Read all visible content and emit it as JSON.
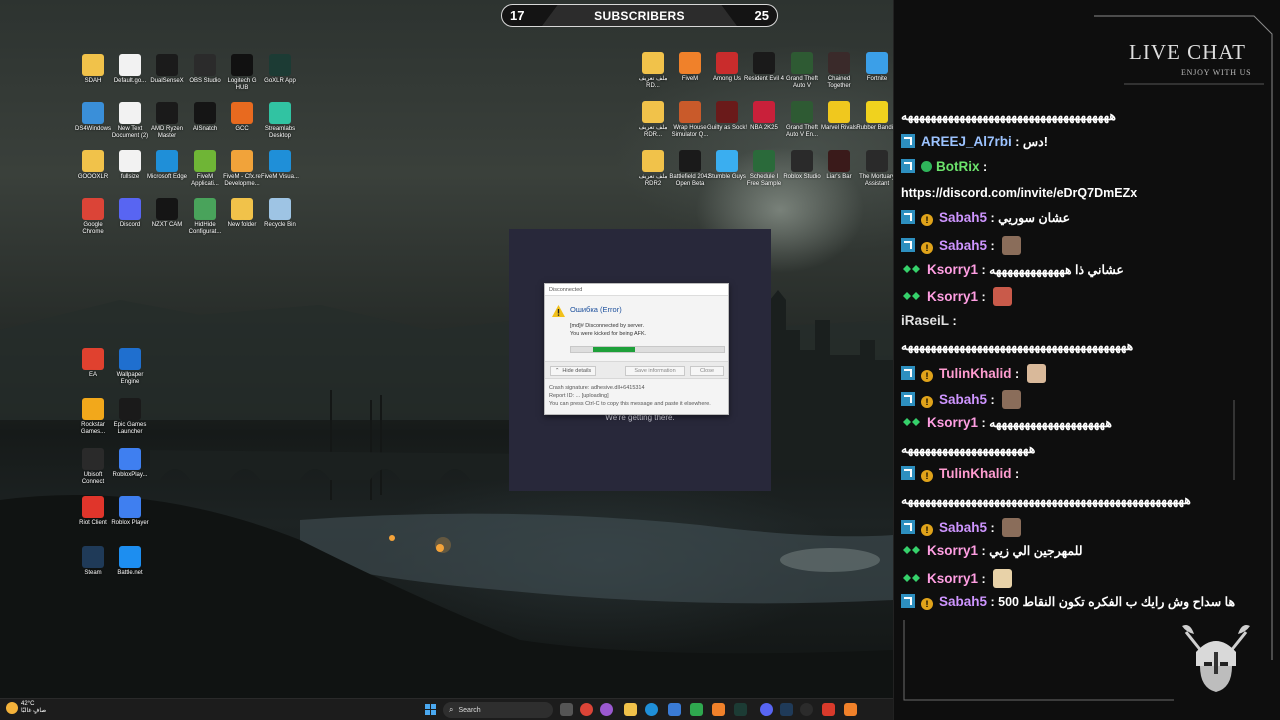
{
  "subscriber_bar": {
    "left": "17",
    "label": "SUBSCRIBERS",
    "right": "25"
  },
  "desktop_icons_left": [
    {
      "label": "SDAH",
      "color": "#f1c24a"
    },
    {
      "label": "Default.go...",
      "color": "#f2f2f2"
    },
    {
      "label": "DualSenseX",
      "color": "#1b1b1b"
    },
    {
      "label": "OBS Studio",
      "color": "#2b2b2b"
    },
    {
      "label": "Logitech G HUB",
      "color": "#111111"
    },
    {
      "label": "GoXLR App",
      "color": "#1c3b34"
    },
    {
      "label": "DS4Windows",
      "color": "#3a8fd9"
    },
    {
      "label": "New Text Document (2)",
      "color": "#f2f2f2"
    },
    {
      "label": "AMD Ryzen Master",
      "color": "#1a1a1a"
    },
    {
      "label": "AISnatch",
      "color": "#151515"
    },
    {
      "label": "GCC",
      "color": "#e86a1f"
    },
    {
      "label": "Streamlabs Desktop",
      "color": "#31c3a2"
    },
    {
      "label": "GOOOXLR",
      "color": "#f1c24a"
    },
    {
      "label": "fullsize",
      "color": "#f2f2f2"
    },
    {
      "label": "Microsoft Edge",
      "color": "#1f8fd8"
    },
    {
      "label": "FiveM Applicati...",
      "color": "#6fb536"
    },
    {
      "label": "FiveM - Cfx.re Developme...",
      "color": "#f1a33a"
    },
    {
      "label": "FiveM Visua...",
      "color": "#1f8fd8"
    },
    {
      "label": "Google Chrome",
      "color": "#db4437"
    },
    {
      "label": "Discord",
      "color": "#5865f2"
    },
    {
      "label": "NZXT CAM",
      "color": "#151515"
    },
    {
      "label": "HidHide Configurat...",
      "color": "#49a35b"
    },
    {
      "label": "New folder",
      "color": "#f1c24a"
    },
    {
      "label": "Recycle Bin",
      "color": "#9ec4e4"
    },
    {
      "label": "EA",
      "color": "#e0412f"
    },
    {
      "label": "Wallpaper Engine",
      "color": "#1f6fcf"
    },
    {
      "label": "Rockstar Games...",
      "color": "#f2a81b"
    },
    {
      "label": "Epic Games Launcher",
      "color": "#1a1a1a"
    },
    {
      "label": "Ubisoft Connect",
      "color": "#2a2a2a"
    },
    {
      "label": "RobloxPlay...",
      "color": "#3f7ff0"
    },
    {
      "label": "Riot Client",
      "color": "#e0352b"
    },
    {
      "label": "Roblox Player",
      "color": "#3f7ff0"
    },
    {
      "label": "Steam",
      "color": "#1f3a58"
    },
    {
      "label": "Battle.net",
      "color": "#1d8ef0"
    }
  ],
  "desktop_icons_right": [
    {
      "label": "ملف تعريف RD...",
      "color": "#f1c24a"
    },
    {
      "label": "FiveM",
      "color": "#f0812a"
    },
    {
      "label": "Among Us",
      "color": "#c92c2c"
    },
    {
      "label": "Resident Evil 4",
      "color": "#1a1a1a"
    },
    {
      "label": "Grand Theft Auto V",
      "color": "#2e5a33"
    },
    {
      "label": "Chained Together",
      "color": "#3a2a2a"
    },
    {
      "label": "Fortnite",
      "color": "#3b9fe8"
    },
    {
      "label": "ملف تعريف RDR...",
      "color": "#f1c24a"
    },
    {
      "label": "Wrap House Simulator Q...",
      "color": "#c95a2a"
    },
    {
      "label": "Guilty as Sock!",
      "color": "#6a1a1a"
    },
    {
      "label": "NBA 2K25",
      "color": "#c9203a"
    },
    {
      "label": "Grand Theft Auto V En...",
      "color": "#2e5a33"
    },
    {
      "label": "Marvel Rivals",
      "color": "#f0c81e"
    },
    {
      "label": "Rubber Bandits",
      "color": "#f0d21e"
    },
    {
      "label": "ملف تعريف RDR2",
      "color": "#f1c24a"
    },
    {
      "label": "Battlefield 2042 Open Beta",
      "color": "#1a1a1a"
    },
    {
      "label": "Stumble Guys",
      "color": "#3aaef0"
    },
    {
      "label": "Schedule I Free Sample",
      "color": "#2a6a3a"
    },
    {
      "label": "Roblox Studio",
      "color": "#2a2a2a"
    },
    {
      "label": "Liar's Bar",
      "color": "#3a1a1a"
    },
    {
      "label": "The Mortuary Assistant",
      "color": "#2a2a2a"
    }
  ],
  "loading_window": {
    "status": "We're getting there."
  },
  "error_dialog": {
    "title": "Disconnected",
    "heading": "Ошибка (Error)",
    "line1": "[md]# Disconnected by server.",
    "line2": "You were kicked for being AFK.",
    "progress": 0.27,
    "hide_details": "Hide details",
    "save_information": "Save information",
    "close": "Close",
    "crash_signature": "Crash signature: adhesive.dll+6415314",
    "report_id": "Report ID: ... [uploading]",
    "copy_hint": "You can press Ctrl-C to copy this message and paste it elsewhere."
  },
  "taskbar": {
    "temperature": "42°C",
    "weather_desc": "صافٍ غالبًا",
    "search_placeholder": "Search"
  },
  "chat": {
    "title": "LIVE CHAT",
    "subtitle": "ENJOY WITH US",
    "messages": [
      {
        "badges": [],
        "user": "",
        "user_color": "#ffffff",
        "text": "ههههههههههههههههههههههههههههههههههههه"
      },
      {
        "badges": [
          "mod"
        ],
        "user": "AREEJ_Al7rbi",
        "user_color": "#9cc3ff",
        "text": "دس!"
      },
      {
        "badges": [
          "mod",
          "ok"
        ],
        "user": "BotRix",
        "user_color": "#6ce36c",
        "text": ""
      },
      {
        "badges": [],
        "user": "",
        "user_color": "#ffffff",
        "text": "https://discord.com/invite/eDrQ7DmEZx"
      },
      {
        "badges": [
          "mod",
          "sub"
        ],
        "user": "Sabah5",
        "user_color": "#ce95ff",
        "text": "عشان سوريي"
      },
      {
        "badges": [
          "mod",
          "sub"
        ],
        "user": "Sabah5",
        "user_color": "#ce95ff",
        "text": "",
        "emote": "#8a6d5a"
      },
      {
        "badges": [
          "vip"
        ],
        "user": "Ksorry1",
        "user_color": "#ff9ee2",
        "text": "عشاني ذا هههههههههههههه"
      },
      {
        "badges": [
          "vip"
        ],
        "user": "Ksorry1",
        "user_color": "#ff9ee2",
        "text": "",
        "emote": "#c95a4a"
      },
      {
        "badges": [],
        "user": "iRaseiL",
        "user_color": "#e0e0e0",
        "text": ""
      },
      {
        "badges": [],
        "user": "",
        "user_color": "#ffffff",
        "text": "هههههههههههههههههههههههههههههههههههههههه"
      },
      {
        "badges": [
          "mod",
          "sub"
        ],
        "user": "TulinKhalid",
        "user_color": "#ff9cd0",
        "text": "",
        "emote": "#d9b99a"
      },
      {
        "badges": [
          "mod",
          "sub"
        ],
        "user": "Sabah5",
        "user_color": "#ce95ff",
        "text": "",
        "emote": "#8a6d5a"
      },
      {
        "badges": [
          "vip"
        ],
        "user": "Ksorry1",
        "user_color": "#ff9ee2",
        "text": "ههههههههههههههههههههه"
      },
      {
        "badges": [],
        "user": "",
        "user_color": "#ffffff",
        "text": "ههههههههههههههههههههههه"
      },
      {
        "badges": [
          "mod",
          "sub"
        ],
        "user": "TulinKhalid",
        "user_color": "#ff9cd0",
        "text": ""
      },
      {
        "badges": [],
        "user": "",
        "user_color": "#ffffff",
        "text": "هههههههههههههههههههههههههههههههههههههههههههههههههه"
      },
      {
        "badges": [
          "mod",
          "sub"
        ],
        "user": "Sabah5",
        "user_color": "#ce95ff",
        "text": "",
        "emote": "#8a6d5a"
      },
      {
        "badges": [
          "vip"
        ],
        "user": "Ksorry1",
        "user_color": "#ff9ee2",
        "text": "للمهرجين الي زيي"
      },
      {
        "badges": [
          "vip"
        ],
        "user": "Ksorry1",
        "user_color": "#ff9ee2",
        "text": "",
        "emote": "#e8d2a8"
      },
      {
        "badges": [
          "mod",
          "sub"
        ],
        "user": "Sabah5",
        "user_color": "#ce95ff",
        "text": "ها سداح وش رايك ب الفكره تكون النقاط 500"
      }
    ]
  }
}
